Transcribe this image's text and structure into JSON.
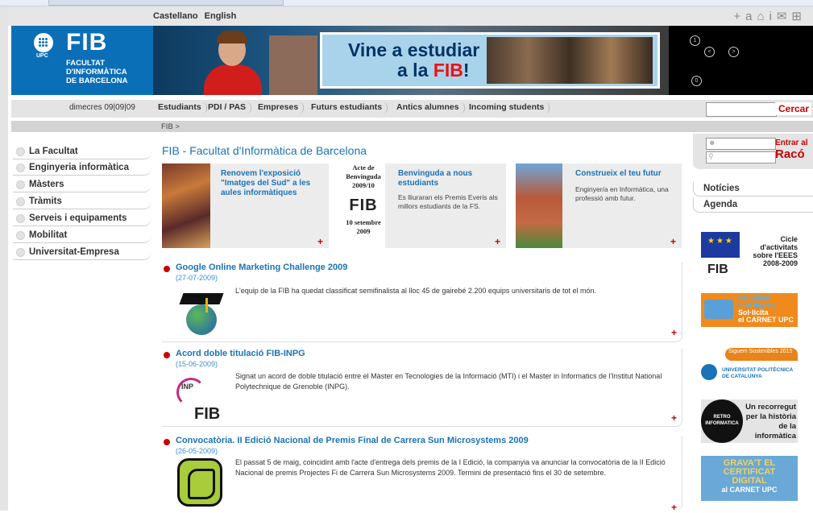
{
  "languages": [
    "Castellano",
    "English"
  ],
  "util_icons": [
    "+a",
    "⌂",
    "i",
    "✉",
    "⊞"
  ],
  "header": {
    "logo_text": "FIB",
    "logo_sub": "UPC",
    "faculty_name": [
      "FACULTAT",
      "D'INFORMÀTICA",
      "DE BARCELONA"
    ],
    "banner_line1": "Vine a estudiar",
    "banner_line2a": "a la ",
    "banner_line2b": "FIB",
    "banner_line2c": "!"
  },
  "date": "dimecres 09|09|09",
  "nav": {
    "tabs": [
      "Estudiants",
      "PDI / PAS",
      "Empreses",
      "Futurs estudiants",
      "Antics alumnes",
      "Incoming students"
    ],
    "search_button": "Cercar"
  },
  "breadcrumb": "FIB >",
  "left_nav": [
    "La Facultat",
    "Enginyeria informàtica",
    "Màsters",
    "Tràmits",
    "Serveis i equipaments",
    "Mobilitat",
    "Universitat-Empresa"
  ],
  "page_title": "FIB - Facultat d'Informàtica de Barcelona",
  "features": [
    {
      "title": "Renovem l'exposició \"Imatges del Sud\" a les aules informàtiques",
      "desc": ""
    },
    {
      "title": "Benvinguda a nous estudiants",
      "desc": "Es lliuraran els Premis Everis als millors estudiants de la FS."
    },
    {
      "title": "Construeix el teu futur",
      "desc": "Enginyer/a en Informàtica, una professió amb futur."
    }
  ],
  "acte": {
    "line1": "Acte de Benvinguda 2009/10",
    "logo": "FIB",
    "line2": "10 setembre 2009"
  },
  "news": [
    {
      "title": "Google Online Marketing Challenge 2009",
      "date": "(27-07-2009)",
      "body": "L'equip de la FIB ha quedat classificat semifinalista al lloc 45 de gairebé 2.200 equips universitaris de tot el món."
    },
    {
      "title": "Acord doble titulació FIB-INPG",
      "date": "(15-06-2009)",
      "body": "Signat un acord de doble titulació entre el Màster en Tecnologies de la Informació (MTI) i el Master in Informatics de l'Institut National Polytechnique de Grenoble (INPG).",
      "logo": "FIB",
      "logo_small": "INP"
    },
    {
      "title": "Convocatòria. II Edició Nacional de Premis Final de Carrera Sun Microsystems 2009",
      "date": "(26-05-2009)",
      "body": "El passat 5 de maig, coincidint amb l'acte d'entrega dels premis de la I Edició, la companyia va anunciar la convocatòria de la II Edició Nacional de premis Projectes Fi de Carrera Sun Microsystems 2009. Termini de presentació fins el 30 de setembre."
    }
  ],
  "plus": "+",
  "login": {
    "button_line1": "Entrar al",
    "button_line2": "Racó"
  },
  "right_nav": [
    "Notícies",
    "Agenda"
  ],
  "promos": {
    "eees": {
      "text": [
        "Cicle",
        "d'activitats",
        "sobre l'EEES",
        "2008-2009"
      ],
      "logo": "FIB"
    },
    "carnet": {
      "text": [
        "estudiant",
        "nou ingrés",
        "Sol·licita",
        "el CARNET UPC"
      ]
    },
    "upc": {
      "tag": "Siguem Sostenibles 2015",
      "text": [
        "UNIVERSITAT POLITÈCNICA",
        "DE CATALUNYA"
      ]
    },
    "retro": {
      "badge": [
        "RETRO",
        "INFORMATICA"
      ],
      "text": [
        "Un recorregut",
        "per la història",
        "de la",
        "informàtica"
      ]
    },
    "certificat": {
      "text": [
        "GRAVA'T EL",
        "CERTIFICAT",
        "DIGITAL",
        "al CARNET UPC"
      ]
    }
  }
}
